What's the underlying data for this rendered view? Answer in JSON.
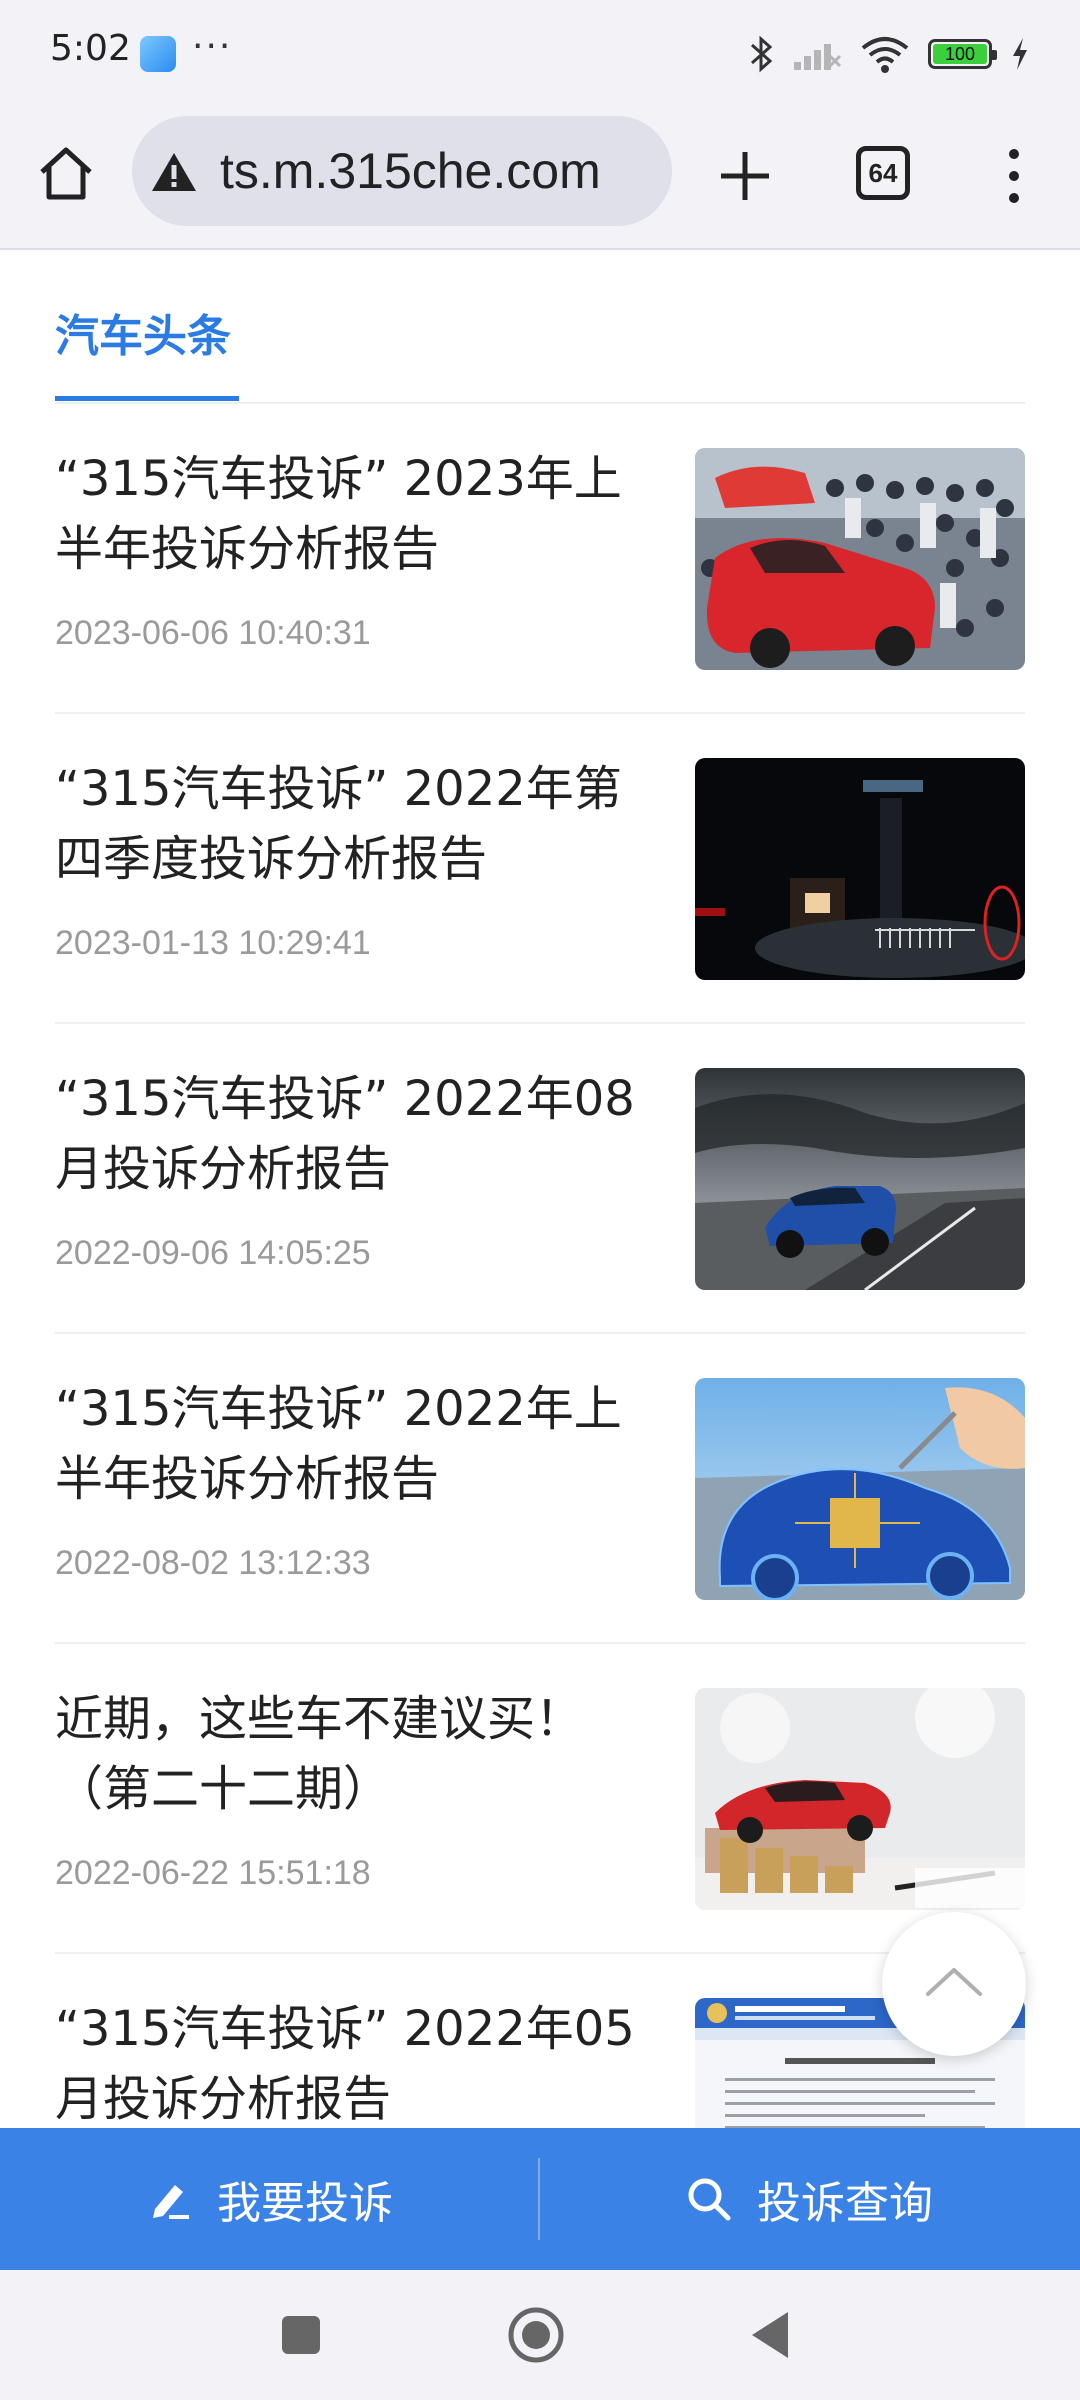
{
  "status_bar": {
    "time": "5:02",
    "more": "···",
    "battery": "100",
    "icons": [
      "app-icon",
      "bluetooth-icon",
      "signal-icon",
      "wifi-icon",
      "battery-icon",
      "charging-icon"
    ]
  },
  "browser": {
    "url": "ts.m.315che.com",
    "tab_count": "64",
    "icons": [
      "home-icon",
      "warning-icon",
      "plus-icon",
      "tabs-icon",
      "menu-icon"
    ]
  },
  "section": {
    "tab_label": "汽车头条",
    "accent_color": "#2a7be4"
  },
  "news": [
    {
      "title": "“315汽车投诉” 2023年上半年投诉分析报告",
      "date": "2023-06-06 10:40:31",
      "thumb": "car-show-photo"
    },
    {
      "title": "“315汽车投诉” 2022年第四季度投诉分析报告",
      "date": "2023-01-13 10:29:41",
      "thumb": "night-gate-photo"
    },
    {
      "title": "“315汽车投诉” 2022年08月投诉分析报告",
      "date": "2022-09-06 14:05:25",
      "thumb": "blue-suv-road-photo"
    },
    {
      "title": "“315汽车投诉” 2022年上半年投诉分析报告",
      "date": "2022-08-02 13:12:33",
      "thumb": "car-chip-illustration"
    },
    {
      "title": "近期，这些车不建议买！（第二十二期）",
      "date": "2022-06-22 15:51:18",
      "thumb": "red-car-coins-photo"
    },
    {
      "title": "“315汽车投诉” 2022年05月投诉分析报告",
      "date": "",
      "thumb": "ministry-document-photo"
    }
  ],
  "actions": {
    "complain_label": "我要投诉",
    "query_label": "投诉查询",
    "bar_color": "#3b82e6"
  },
  "nav": {
    "icons": [
      "recent-apps-icon",
      "home-circle-icon",
      "back-icon"
    ]
  }
}
